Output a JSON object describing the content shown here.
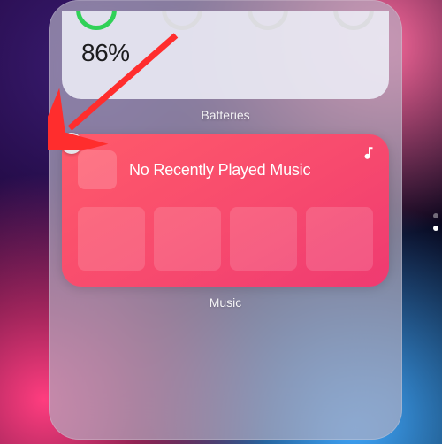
{
  "batteries": {
    "label": "Batteries",
    "percentage": "86%"
  },
  "music": {
    "label": "Music",
    "title": "No Recently Played Music",
    "icon_name": "music-note-icon"
  },
  "remove_button": {
    "name": "remove-widget-button"
  },
  "colors": {
    "music_widget_start": "#ff5a6a",
    "music_widget_end": "#ef3a71",
    "battery_ring_active": "#30d158"
  },
  "page_indicator": {
    "total": 2,
    "active": 2
  }
}
